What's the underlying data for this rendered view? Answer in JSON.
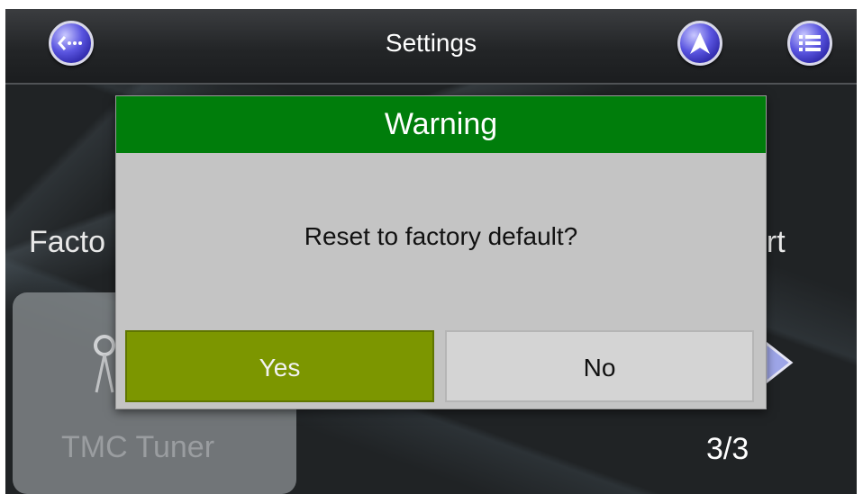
{
  "header": {
    "title": "Settings",
    "back_icon": "back-more-icon",
    "navigation_icon": "navigation-arrow-icon",
    "menu_icon": "list-menu-icon"
  },
  "background": {
    "left_item_label": "Facto",
    "right_item_label": "ort",
    "tile_label": "TMC Tuner",
    "page_indicator": "3/3"
  },
  "dialog": {
    "title": "Warning",
    "message": "Reset to factory default?",
    "yes_label": "Yes",
    "no_label": "No"
  },
  "colors": {
    "dialog_header": "#007d0b",
    "yes_button": "#7c9600",
    "no_button": "#d4d4d4",
    "round_button": "#4a44d8"
  }
}
